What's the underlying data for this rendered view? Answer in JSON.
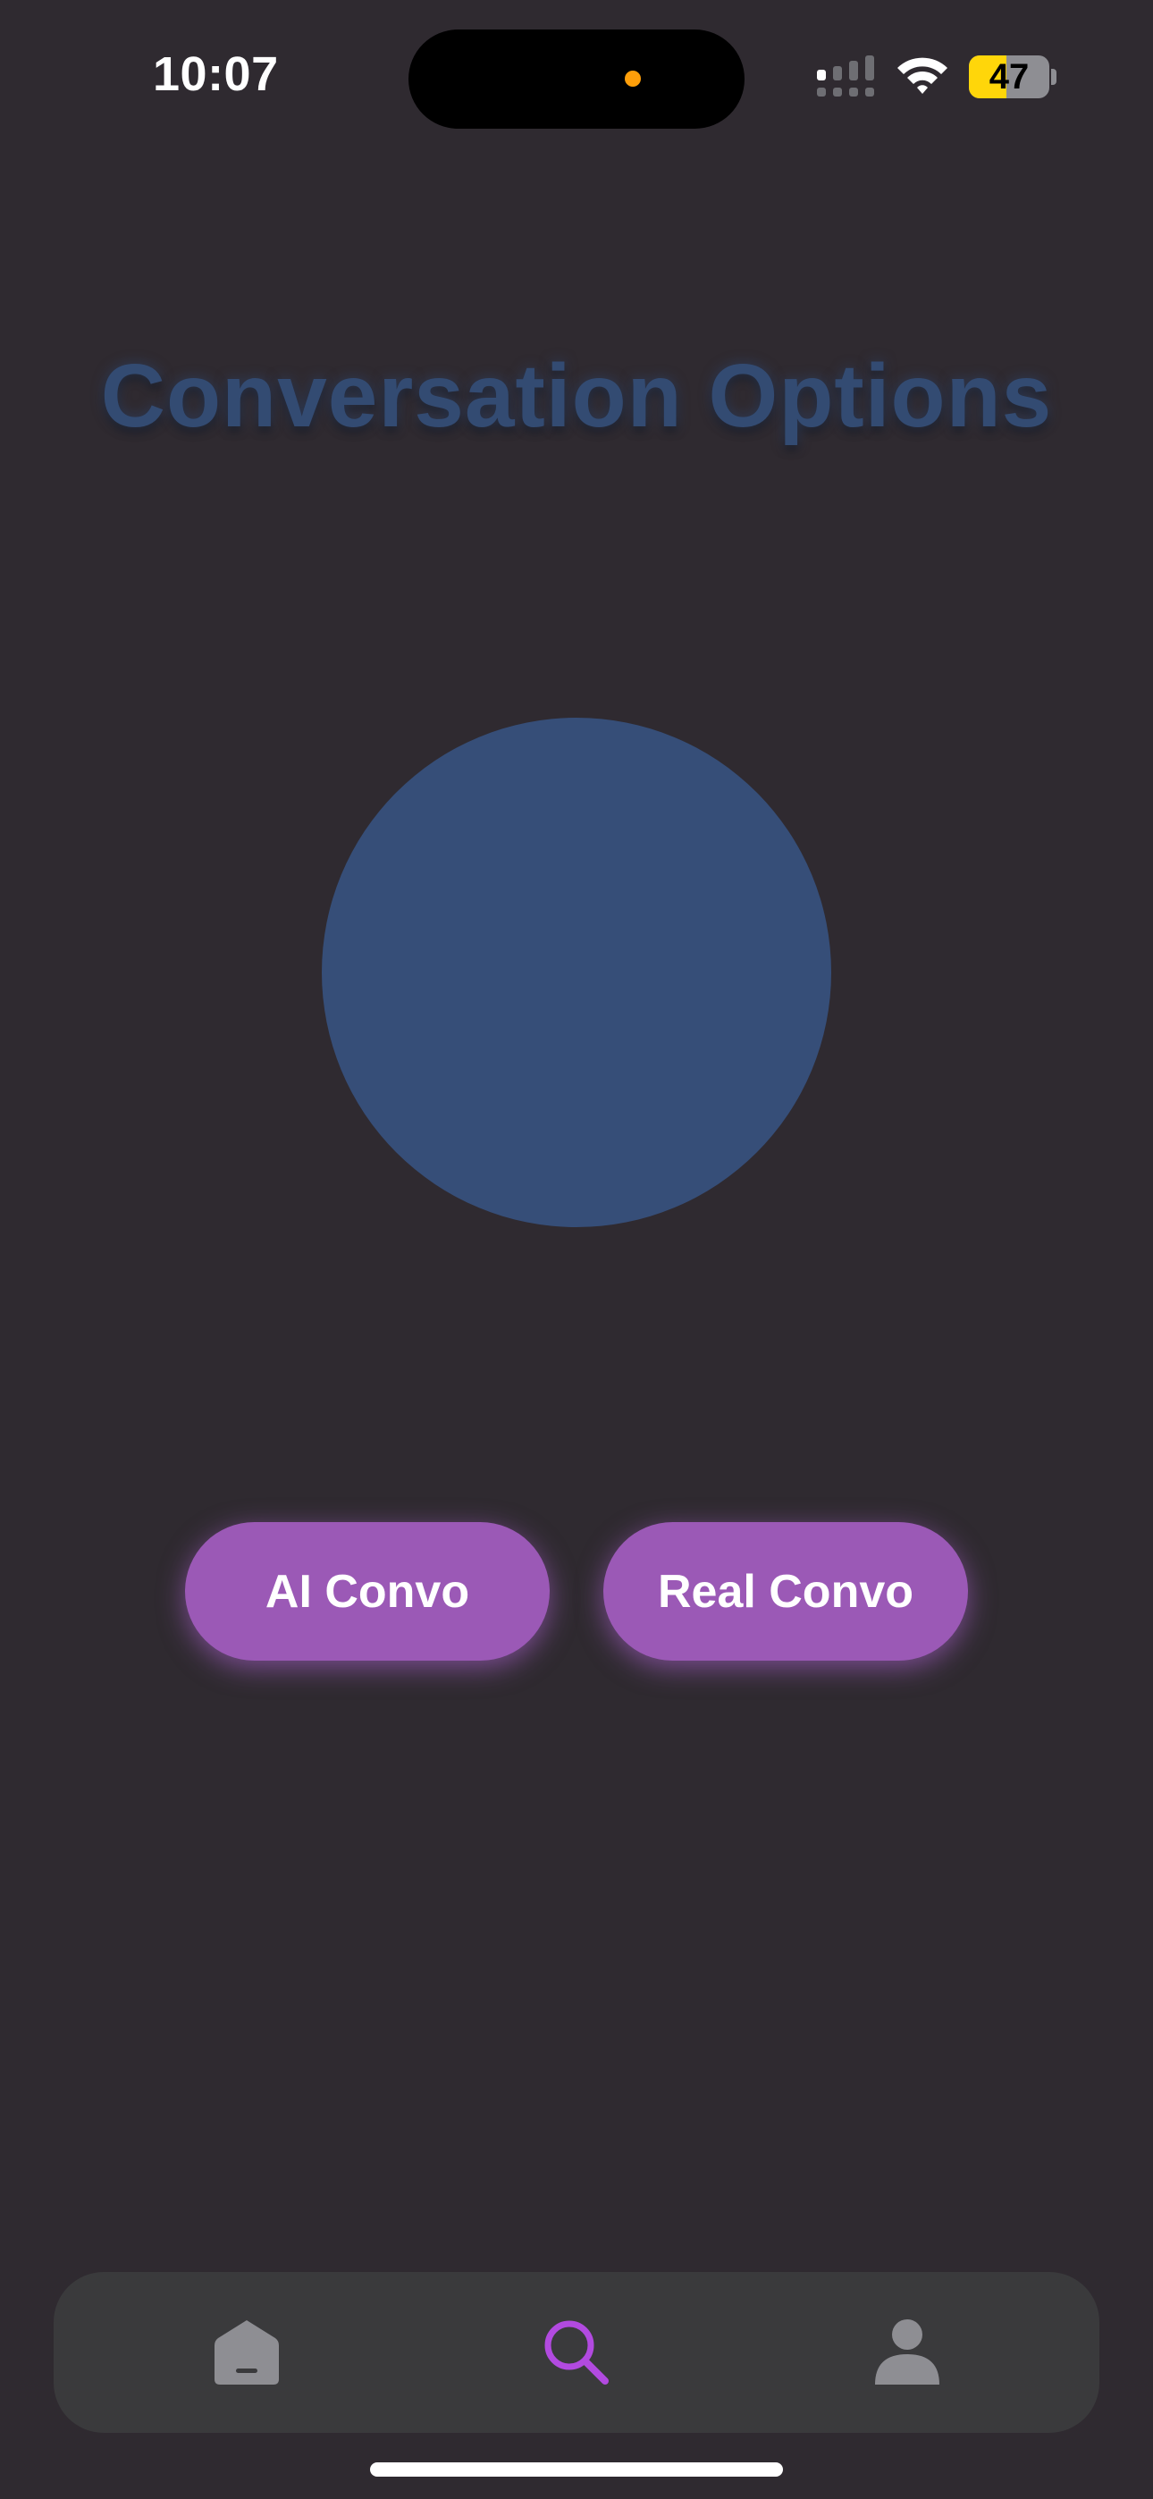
{
  "status_bar": {
    "time": "10:07",
    "battery_level": "47",
    "battery_fraction": 0.47,
    "battery_color": "#ffd60a",
    "camera_indicator_color": "#ff9f0a",
    "signal_icon": "cellular-signal-icon",
    "wifi_icon": "wifi-icon"
  },
  "main": {
    "title": "Conversation Options",
    "title_color": "#334b72",
    "orb_color": "#364e78",
    "buttons": [
      {
        "label": "AI Convo",
        "color": "#9b59b6"
      },
      {
        "label": "Real Convo",
        "color": "#9b59b6"
      }
    ]
  },
  "tab_bar": {
    "items": [
      {
        "icon": "home-icon",
        "active": false
      },
      {
        "icon": "search-icon",
        "active": true
      },
      {
        "icon": "profile-icon",
        "active": false
      }
    ],
    "active_color": "#b24ae0",
    "inactive_color": "#8e8e93"
  }
}
